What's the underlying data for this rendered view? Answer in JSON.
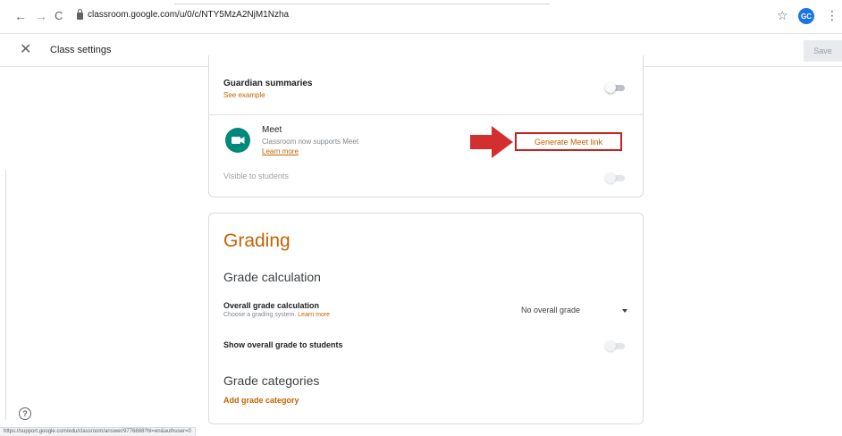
{
  "browser": {
    "back": "←",
    "forward": "→",
    "reload": "C",
    "url": "classroom.google.com/u/0/c/NTY5MzA2NjM1Nzha",
    "avatar_initials": "GC",
    "status_url": "https://support.google.com/edu/classroom/answer/9776888?hl=en&authuser=0"
  },
  "header": {
    "close": "✕",
    "title": "Class settings",
    "save_label": "Save"
  },
  "settings": {
    "guardian": {
      "title": "Guardian summaries",
      "link": "See example"
    },
    "meet": {
      "title": "Meet",
      "subtitle": "Classroom now supports Meet",
      "learn_more": "Learn more",
      "generate_label": "Generate Meet link",
      "visible_label": "Visible to students"
    }
  },
  "grading": {
    "title": "Grading",
    "calc_heading": "Grade calculation",
    "overall_title": "Overall grade calculation",
    "overall_desc": "Choose a grading system.",
    "overall_learn_more": "Learn more",
    "overall_value": "No overall grade",
    "show_overall": "Show overall grade to students",
    "categories_heading": "Grade categories",
    "add_category": "Add grade category"
  },
  "help_icon": "?",
  "colors": {
    "accent": "#c26401",
    "highlight": "#c5221f",
    "meet_green": "#00897b"
  }
}
